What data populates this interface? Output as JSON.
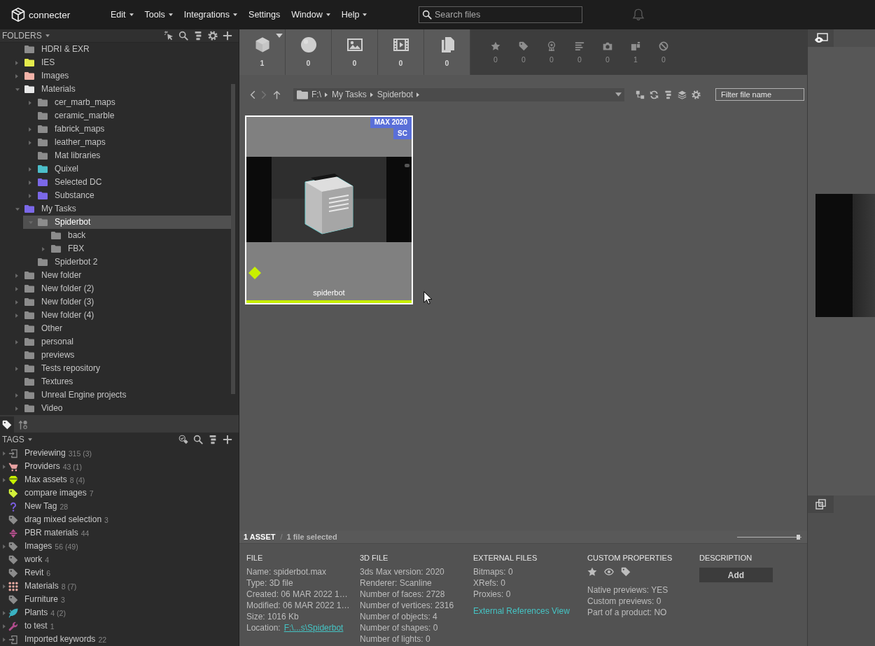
{
  "app": {
    "name": "connecter"
  },
  "menu": [
    {
      "label": "Edit",
      "dropdown": true
    },
    {
      "label": "Tools",
      "dropdown": true
    },
    {
      "label": "Integrations",
      "dropdown": true
    },
    {
      "label": "Settings",
      "dropdown": false
    },
    {
      "label": "Window",
      "dropdown": true
    },
    {
      "label": "Help",
      "dropdown": true
    }
  ],
  "search": {
    "placeholder": "Search files"
  },
  "folders": {
    "title": "FOLDERS",
    "items": [
      {
        "name": "HDRI & EXR",
        "color": "#8c8c8c",
        "selected": false
      },
      {
        "name": "IES",
        "color": "#e4ea4c",
        "selected": false,
        "expanded": false
      },
      {
        "name": "Images",
        "color": "#f2b2a8",
        "selected": false,
        "expanded": false
      },
      {
        "name": "Materials",
        "color": "#e8e8e8",
        "selected": false,
        "expanded": true,
        "children": [
          {
            "name": "cer_marb_maps",
            "color": "#8c8c8c",
            "selected": false,
            "expanded": false
          },
          {
            "name": "ceramic_marble",
            "color": "#8c8c8c",
            "selected": false
          },
          {
            "name": "fabrick_maps",
            "color": "#8c8c8c",
            "selected": false,
            "expanded": false
          },
          {
            "name": "leather_maps",
            "color": "#8c8c8c",
            "selected": false,
            "expanded": false
          },
          {
            "name": "Mat libraries",
            "color": "#8c8c8c",
            "selected": false
          },
          {
            "name": "Quixel",
            "color": "#4cbfca",
            "selected": false,
            "expanded": false
          },
          {
            "name": "Selected DC",
            "color": "#7b68e8",
            "selected": false,
            "expanded": false
          },
          {
            "name": "Substance",
            "color": "#7b68e8",
            "selected": false,
            "expanded": false
          }
        ]
      },
      {
        "name": "My Tasks",
        "color": "#7b68e8",
        "selected": false,
        "expanded": true,
        "children": [
          {
            "name": "Spiderbot",
            "color": "#8c8c8c",
            "selected": true,
            "expanded": true,
            "children": [
              {
                "name": "back",
                "color": "#8c8c8c",
                "selected": false
              },
              {
                "name": "FBX",
                "color": "#8c8c8c",
                "selected": false,
                "expanded": false
              }
            ]
          },
          {
            "name": "Spiderbot 2",
            "color": "#8c8c8c",
            "selected": false
          }
        ]
      },
      {
        "name": "New folder",
        "color": "#8c8c8c",
        "selected": false,
        "expanded": false
      },
      {
        "name": "New folder (2)",
        "color": "#8c8c8c",
        "selected": false,
        "expanded": false
      },
      {
        "name": "New folder (3)",
        "color": "#8c8c8c",
        "selected": false,
        "expanded": false
      },
      {
        "name": "New folder (4)",
        "color": "#8c8c8c",
        "selected": false,
        "expanded": false
      },
      {
        "name": "Other",
        "color": "#8c8c8c",
        "selected": false
      },
      {
        "name": "personal",
        "color": "#8c8c8c",
        "selected": false,
        "expanded": false
      },
      {
        "name": "previews",
        "color": "#8c8c8c",
        "selected": false
      },
      {
        "name": "Tests repository",
        "color": "#8c8c8c",
        "selected": false,
        "expanded": false
      },
      {
        "name": "Textures",
        "color": "#8c8c8c",
        "selected": false
      },
      {
        "name": "Unreal Engine projects",
        "color": "#8c8c8c",
        "selected": false,
        "expanded": false
      },
      {
        "name": "Video",
        "color": "#8c8c8c",
        "selected": false,
        "expanded": false
      }
    ]
  },
  "panel_tabs": [
    {
      "kind": "tag",
      "selected": true
    },
    {
      "kind": "sort",
      "selected": false
    }
  ],
  "tags": {
    "title": "TAGS",
    "items": [
      {
        "name": "Previewing",
        "count": "315 (3)",
        "kind": "import",
        "color": "#8c8c8c",
        "expanded": false
      },
      {
        "name": "Providers",
        "count": "43 (1)",
        "kind": "cart",
        "color": "#e9a2a2",
        "expanded": false
      },
      {
        "name": "Max assets",
        "count": "8 (4)",
        "kind": "gem",
        "color": "#c6f000",
        "expanded": false
      },
      {
        "name": "compare images",
        "count": "7",
        "kind": "tag",
        "color": "#d2f03a"
      },
      {
        "name": "New Tag",
        "count": "28",
        "kind": "question",
        "color": "#7b5ee0"
      },
      {
        "name": "drag mixed selection",
        "count": "3",
        "kind": "tag",
        "color": "#8c8c8c"
      },
      {
        "name": "PBR materials",
        "count": "44",
        "kind": "cone",
        "color": "#b8508f"
      },
      {
        "name": "Images",
        "count": "56 (49)",
        "kind": "tag",
        "color": "#8c8c8c",
        "expanded": false
      },
      {
        "name": "work",
        "count": "4",
        "kind": "tag",
        "color": "#8c8c8c"
      },
      {
        "name": "Revit",
        "count": "6",
        "kind": "tag",
        "color": "#8c8c8c"
      },
      {
        "name": "Materials",
        "count": "8 (7)",
        "kind": "dots",
        "color": "#e8a9a0",
        "expanded": false
      },
      {
        "name": "Furniture",
        "count": "3",
        "kind": "tag",
        "color": "#8c8c8c"
      },
      {
        "name": "Plants",
        "count": "4 (2)",
        "kind": "leaf",
        "color": "#3ab2c2",
        "expanded": false
      },
      {
        "name": "to test",
        "count": "1",
        "kind": "wrench",
        "color": "#b04c8c",
        "expanded": false
      },
      {
        "name": "Imported keywords",
        "count": "22",
        "kind": "import",
        "color": "#8c8c8c",
        "expanded": false
      }
    ]
  },
  "type_filters": [
    {
      "kind": "cube",
      "count": "1",
      "menu": true
    },
    {
      "kind": "sphere",
      "count": "0",
      "menu": false
    },
    {
      "kind": "image",
      "count": "0",
      "menu": false
    },
    {
      "kind": "film",
      "count": "0",
      "menu": false
    },
    {
      "kind": "documents",
      "count": "0",
      "menu": false
    }
  ],
  "quick_filters": [
    {
      "kind": "star",
      "count": "0"
    },
    {
      "kind": "tag",
      "count": "0"
    },
    {
      "kind": "award",
      "count": "0"
    },
    {
      "kind": "lines",
      "count": "0"
    },
    {
      "kind": "camera",
      "count": "0"
    },
    {
      "kind": "blocks",
      "count": "1"
    },
    {
      "kind": "prohibited",
      "count": "0"
    }
  ],
  "navigation": [
    {
      "kind": "back",
      "disabled": false
    },
    {
      "kind": "forward",
      "disabled": true
    },
    {
      "kind": "up",
      "disabled": false
    }
  ],
  "breadcrumb": {
    "path": [
      "F:\\",
      "My Tasks",
      "Spiderbot"
    ]
  },
  "filter": {
    "placeholder": "Filter file name"
  },
  "assets": [
    {
      "name": "spiderbot",
      "badges": [
        "MAX 2020",
        "SC"
      ],
      "selected": true,
      "color": "#c8f000"
    }
  ],
  "status": {
    "count": "1 ASSET",
    "separator": "/",
    "selection": "1 file selected"
  },
  "zoom_slider": {
    "level": 0.96
  },
  "details": {
    "sections": [
      {
        "kind": "file",
        "title": "FILE",
        "lines": [
          "Name: spiderbot.max",
          "Type: 3D file",
          "Created: 06 MAR 2022 1…",
          "Modified: 06 MAR 2022 1…",
          "Size: 1016 Kb"
        ],
        "location": {
          "label": "Location:",
          "link": "F:\\...s\\Spiderbot"
        }
      },
      {
        "kind": "info",
        "title": "3D FILE",
        "lines": [
          "3ds Max version: 2020",
          "Renderer: Scanline",
          "Number of faces: 2728",
          "Number of vertices: 2316",
          "Number of objects: 4",
          "Number of shapes: 0",
          "Number of lights: 0"
        ]
      },
      {
        "kind": "external",
        "title": "EXTERNAL FILES",
        "lines": [
          "Bitmaps: 0",
          "XRefs: 0",
          "Proxies: 0"
        ],
        "link": "External References View"
      },
      {
        "kind": "custom",
        "title": "CUSTOM PROPERTIES",
        "lines": [
          "Native previews: YES",
          "Custom previews: 0",
          "Part of a product: NO"
        ]
      },
      {
        "kind": "description",
        "title": "DESCRIPTION",
        "button": "Add"
      }
    ]
  }
}
